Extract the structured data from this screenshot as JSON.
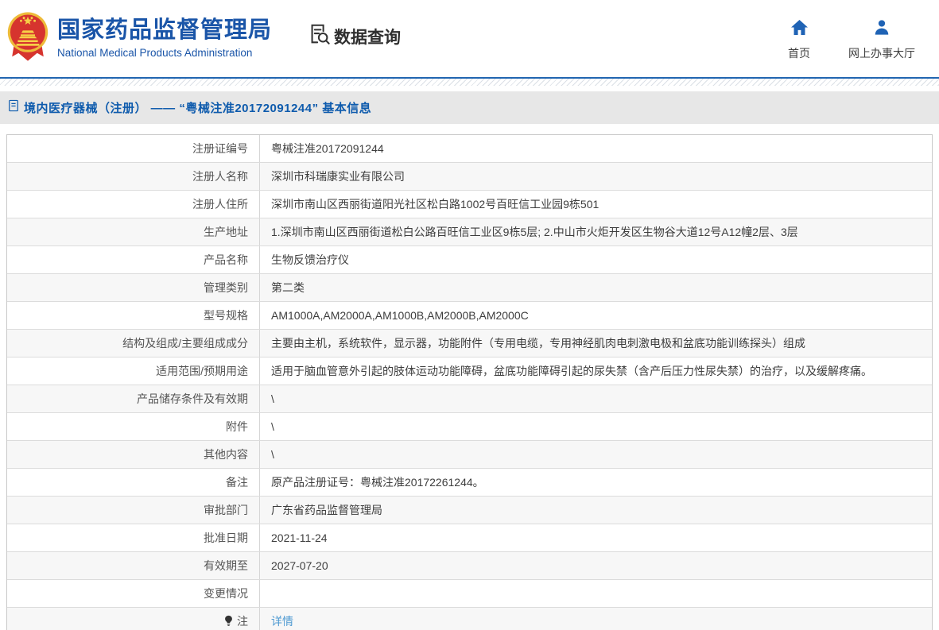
{
  "header": {
    "brand": {
      "title": "国家药品监督管理局",
      "subtitle": "National Medical Products Administration"
    },
    "query_label": "数据查询",
    "nav": [
      {
        "label": "首页",
        "icon": "home-icon"
      },
      {
        "label": "网上办事大厅",
        "icon": "user-icon"
      }
    ]
  },
  "breadcrumb": {
    "icon": "document-icon",
    "text": "境内医疗器械（注册） —— “粤械注准20172091244” 基本信息"
  },
  "table": {
    "rows": [
      {
        "label": "注册证编号",
        "value": "粤械注准20172091244"
      },
      {
        "label": "注册人名称",
        "value": "深圳市科瑞康实业有限公司"
      },
      {
        "label": "注册人住所",
        "value": "深圳市南山区西丽街道阳光社区松白路1002号百旺信工业园9栋501"
      },
      {
        "label": "生产地址",
        "value": "1.深圳市南山区西丽街道松白公路百旺信工业区9栋5层; 2.中山市火炬开发区生物谷大道12号A12幢2层、3层"
      },
      {
        "label": "产品名称",
        "value": "生物反馈治疗仪"
      },
      {
        "label": "管理类别",
        "value": "第二类"
      },
      {
        "label": "型号规格",
        "value": "AM1000A,AM2000A,AM1000B,AM2000B,AM2000C"
      },
      {
        "label": "结构及组成/主要组成成分",
        "value": "主要由主机，系统软件，显示器，功能附件（专用电缆，专用神经肌肉电刺激电极和盆底功能训练探头）组成"
      },
      {
        "label": "适用范围/预期用途",
        "value": "适用于脑血管意外引起的肢体运动功能障碍，盆底功能障碍引起的尿失禁（含产后压力性尿失禁）的治疗，以及缓解疼痛。"
      },
      {
        "label": "产品储存条件及有效期",
        "value": "\\"
      },
      {
        "label": "附件",
        "value": "\\"
      },
      {
        "label": "其他内容",
        "value": "\\"
      },
      {
        "label": "备注",
        "value": "原产品注册证号：粤械注准20172261244。"
      },
      {
        "label": "审批部门",
        "value": "广东省药品监督管理局"
      },
      {
        "label": "批准日期",
        "value": "2021-11-24"
      },
      {
        "label": "有效期至",
        "value": "2027-07-20"
      },
      {
        "label": "变更情况",
        "value": ""
      },
      {
        "label": "注",
        "value": "详情",
        "link": true,
        "label_icon": "bulb-icon"
      }
    ]
  },
  "colors": {
    "brand_blue": "#1a55a8",
    "accent_blue": "#2166b1",
    "breadcrumb_text": "#0e5bad",
    "link_blue": "#4e9ad2",
    "title_bar_bg": "#e7e7e7",
    "row_alt_bg": "#f7f7f7",
    "emblem_red": "#d6342e",
    "emblem_gold": "#eebb39",
    "icon_dark": "#333333",
    "nav_icon_blue": "#1f63b5"
  }
}
